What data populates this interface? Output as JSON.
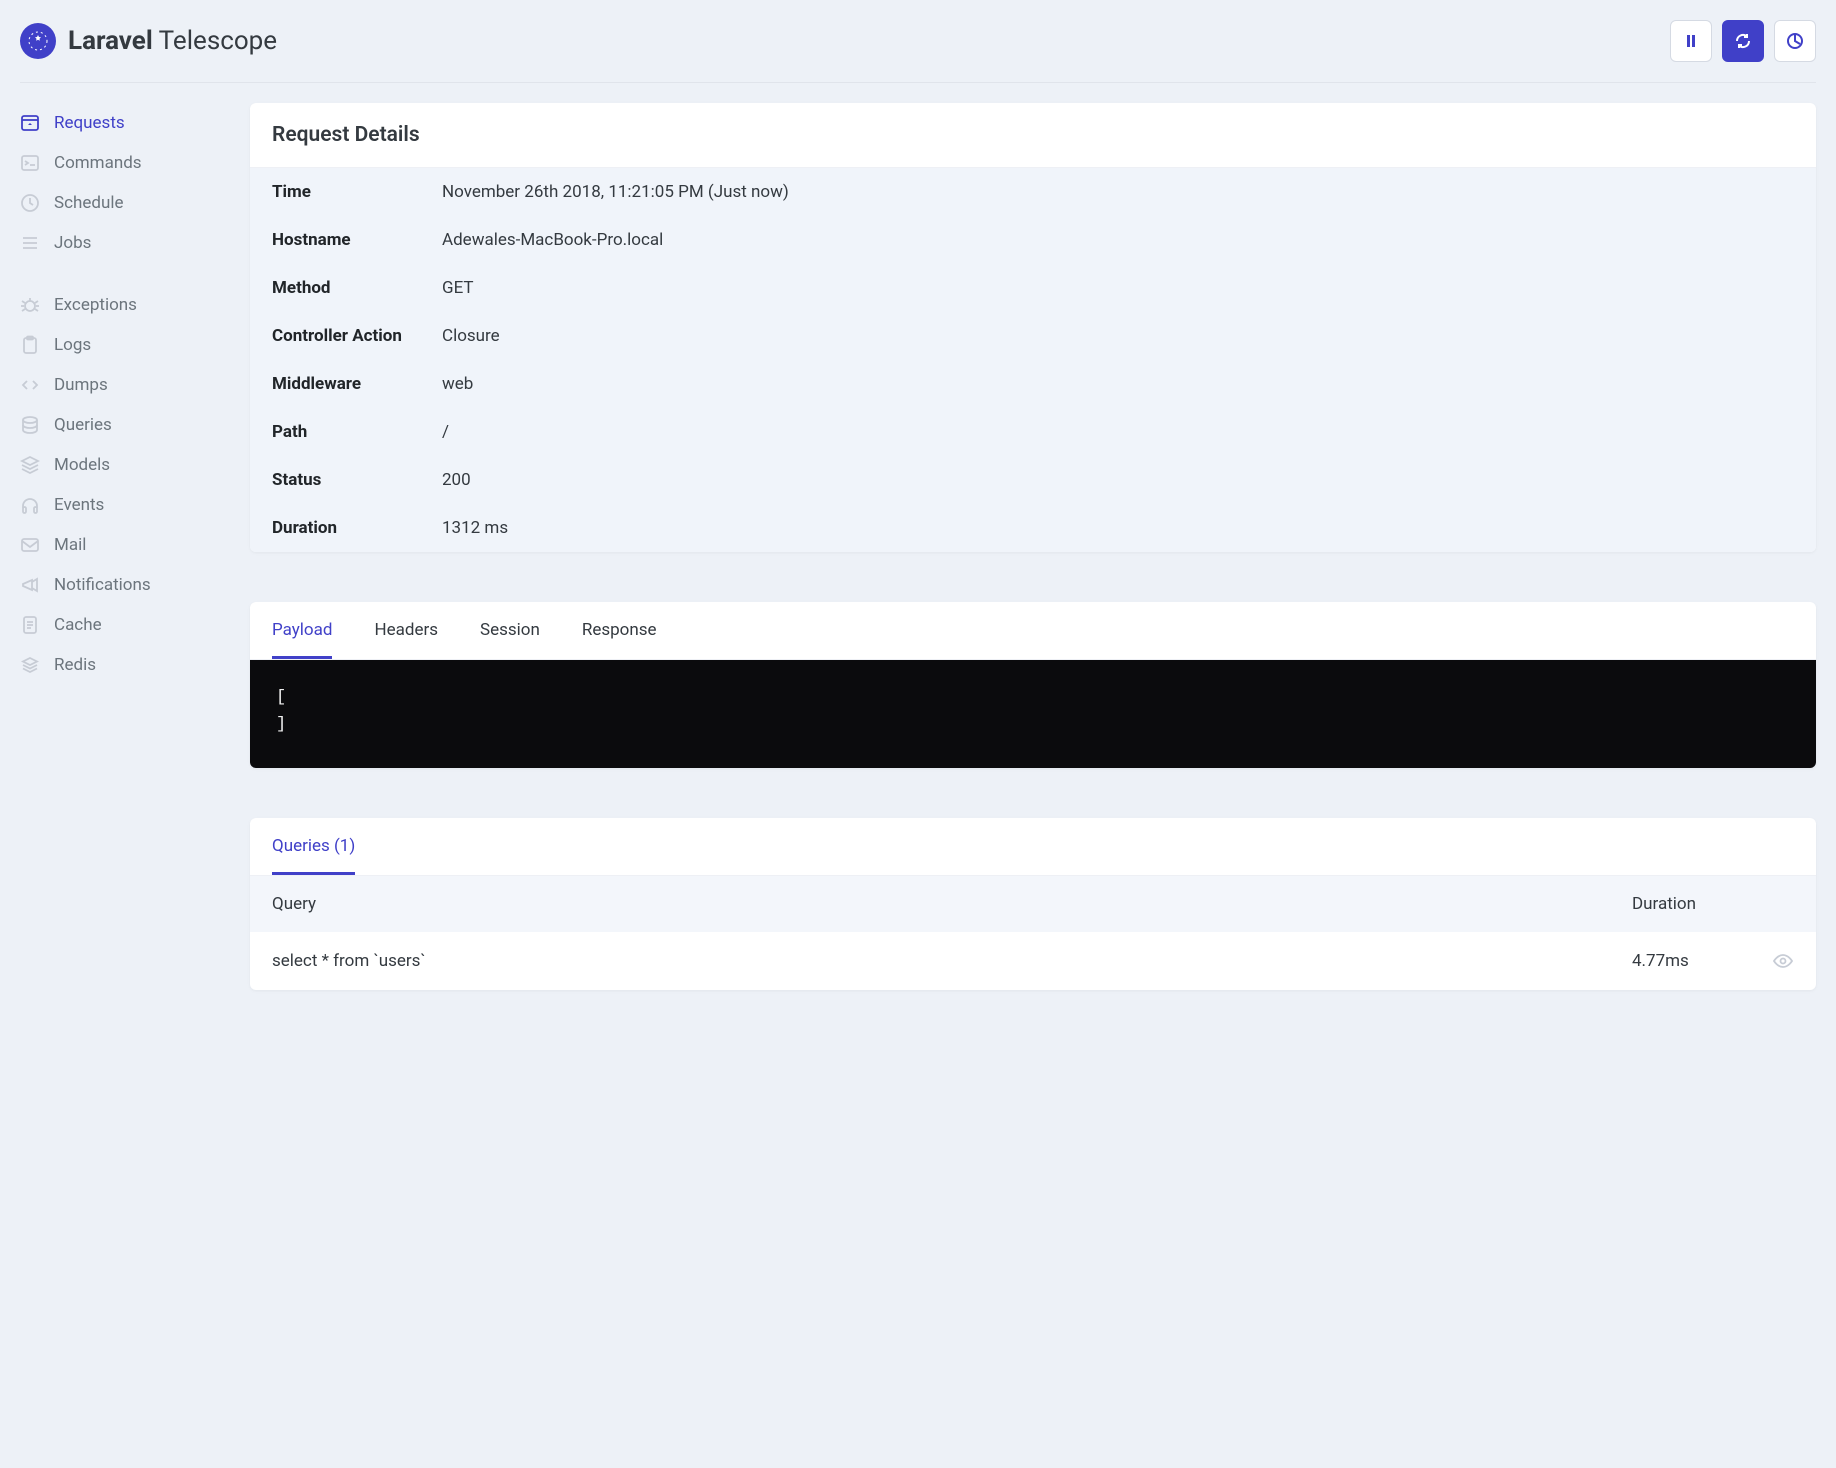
{
  "brand": {
    "strong": "Laravel",
    "suffix": " Telescope"
  },
  "sidebar": {
    "groups": [
      [
        {
          "label": "Requests",
          "icon": "browser-icon",
          "active": true
        },
        {
          "label": "Commands",
          "icon": "terminal-icon",
          "active": false
        },
        {
          "label": "Schedule",
          "icon": "clock-icon",
          "active": false
        },
        {
          "label": "Jobs",
          "icon": "list-icon",
          "active": false
        }
      ],
      [
        {
          "label": "Exceptions",
          "icon": "bug-icon",
          "active": false
        },
        {
          "label": "Logs",
          "icon": "clipboard-icon",
          "active": false
        },
        {
          "label": "Dumps",
          "icon": "code-icon",
          "active": false
        },
        {
          "label": "Queries",
          "icon": "database-icon",
          "active": false
        },
        {
          "label": "Models",
          "icon": "layers-icon",
          "active": false
        },
        {
          "label": "Events",
          "icon": "headphones-icon",
          "active": false
        },
        {
          "label": "Mail",
          "icon": "mail-icon",
          "active": false
        },
        {
          "label": "Notifications",
          "icon": "bullhorn-icon",
          "active": false
        },
        {
          "label": "Cache",
          "icon": "document-icon",
          "active": false
        },
        {
          "label": "Redis",
          "icon": "stack-icon",
          "active": false
        }
      ]
    ]
  },
  "request_details": {
    "title": "Request Details",
    "rows": [
      {
        "label": "Time",
        "value": "November 26th 2018, 11:21:05 PM (Just now)"
      },
      {
        "label": "Hostname",
        "value": "Adewales-MacBook-Pro.local"
      },
      {
        "label": "Method",
        "value": "GET"
      },
      {
        "label": "Controller Action",
        "value": "Closure"
      },
      {
        "label": "Middleware",
        "value": "web"
      },
      {
        "label": "Path",
        "value": "/"
      },
      {
        "label": "Status",
        "value": "200"
      },
      {
        "label": "Duration",
        "value": "1312 ms"
      }
    ]
  },
  "payload_tabs": [
    {
      "label": "Payload",
      "active": true
    },
    {
      "label": "Headers",
      "active": false
    },
    {
      "label": "Session",
      "active": false
    },
    {
      "label": "Response",
      "active": false
    }
  ],
  "payload_code": "[\n]",
  "queries_tab": {
    "label": "Queries (1)"
  },
  "queries": {
    "columns": {
      "query": "Query",
      "duration": "Duration"
    },
    "rows": [
      {
        "query": "select * from `users`",
        "duration": "4.77ms"
      }
    ]
  }
}
